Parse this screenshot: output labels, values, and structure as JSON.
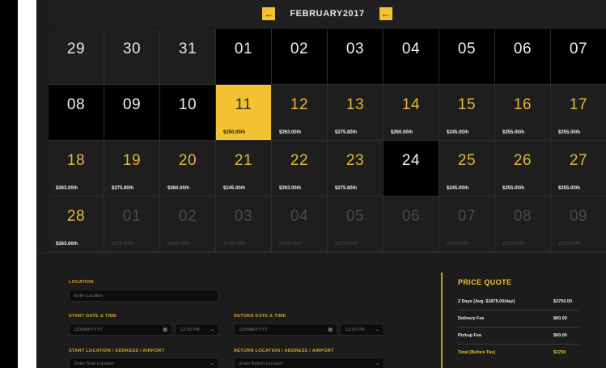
{
  "calendar": {
    "month_label": "FEBRUARY2017",
    "prev_arrow": "←",
    "next_arrow": "←",
    "days": [
      {
        "n": "29",
        "p": "",
        "s": "prev"
      },
      {
        "n": "30",
        "p": "",
        "s": "prev"
      },
      {
        "n": "31",
        "p": "",
        "s": "prev"
      },
      {
        "n": "01",
        "p": "",
        "s": "black"
      },
      {
        "n": "02",
        "p": "",
        "s": "black"
      },
      {
        "n": "03",
        "p": "",
        "s": "black"
      },
      {
        "n": "04",
        "p": "",
        "s": "black"
      },
      {
        "n": "05",
        "p": "",
        "s": "black"
      },
      {
        "n": "06",
        "p": "",
        "s": "black"
      },
      {
        "n": "07",
        "p": "",
        "s": "black"
      },
      {
        "n": "08",
        "p": "",
        "s": "black"
      },
      {
        "n": "09",
        "p": "",
        "s": "black"
      },
      {
        "n": "10",
        "p": "",
        "s": "black"
      },
      {
        "n": "11",
        "p": "$250.00/h",
        "s": "selected"
      },
      {
        "n": "12",
        "p": "$263.00/h",
        "s": "avail"
      },
      {
        "n": "13",
        "p": "$275.80/h",
        "s": "avail"
      },
      {
        "n": "14",
        "p": "$260.00/h",
        "s": "avail"
      },
      {
        "n": "15",
        "p": "$245.00/h",
        "s": "avail"
      },
      {
        "n": "16",
        "p": "$255.00/h",
        "s": "avail"
      },
      {
        "n": "17",
        "p": "$255.00/h",
        "s": "avail"
      },
      {
        "n": "18",
        "p": "$263.00/h",
        "s": "avail"
      },
      {
        "n": "19",
        "p": "$275.80/h",
        "s": "avail"
      },
      {
        "n": "20",
        "p": "$260.00/h",
        "s": "avail"
      },
      {
        "n": "21",
        "p": "$245.00/h",
        "s": "avail"
      },
      {
        "n": "22",
        "p": "$263.00/h",
        "s": "avail"
      },
      {
        "n": "23",
        "p": "$275.80/h",
        "s": "avail"
      },
      {
        "n": "24",
        "p": "",
        "s": "black"
      },
      {
        "n": "25",
        "p": "$245.00/h",
        "s": "avail"
      },
      {
        "n": "26",
        "p": "$255.00/h",
        "s": "avail"
      },
      {
        "n": "27",
        "p": "$255.00/h",
        "s": "avail"
      },
      {
        "n": "28",
        "p": "$263.00/h",
        "s": "avail"
      },
      {
        "n": "01",
        "p": "$275.80/h",
        "s": "next"
      },
      {
        "n": "02",
        "p": "$260.00/h",
        "s": "next"
      },
      {
        "n": "03",
        "p": "$245.00/h",
        "s": "next"
      },
      {
        "n": "04",
        "p": "$263.00/h",
        "s": "next"
      },
      {
        "n": "05",
        "p": "$275.80/h",
        "s": "next"
      },
      {
        "n": "06",
        "p": "",
        "s": "next"
      },
      {
        "n": "07",
        "p": "$245.00/h",
        "s": "next"
      },
      {
        "n": "08",
        "p": "$255.00/h",
        "s": "next"
      },
      {
        "n": "09",
        "p": "$255.00/h",
        "s": "next"
      }
    ]
  },
  "form": {
    "location_label": "LOCATION",
    "location_placeholder": "Enter Location",
    "start_label": "START DATE & TIME",
    "start_date_placeholder": "DD/MM/YYYY",
    "start_time": "12:00 PM",
    "return_label": "RETURN DATE & TIME",
    "return_date_placeholder": "DD/MM/YYYY",
    "return_time": "12:00 PM",
    "start_loc_label": "START LOCATION / ADDRESS / AIRPORT",
    "start_loc_placeholder": "Enter Start Location",
    "return_loc_label": "RETURN LOCATION / ADDRESS / AIRPORT",
    "return_loc_placeholder": "Enter Return Location"
  },
  "quote": {
    "title": "PRICE QUOTE",
    "rows": [
      {
        "k": "2 Days [Avg. $1875.00/day]",
        "v": "$3750.00"
      },
      {
        "k": "Delivery Fee",
        "v": "$00.00"
      },
      {
        "k": "Pickup Fee",
        "v": "$00.00"
      }
    ],
    "total_label": "Total [Before Tax]",
    "total_value": "$3750"
  },
  "colors": {
    "accent": "#f2c230",
    "background": "#1c1c1c",
    "black_cell": "#000000"
  }
}
